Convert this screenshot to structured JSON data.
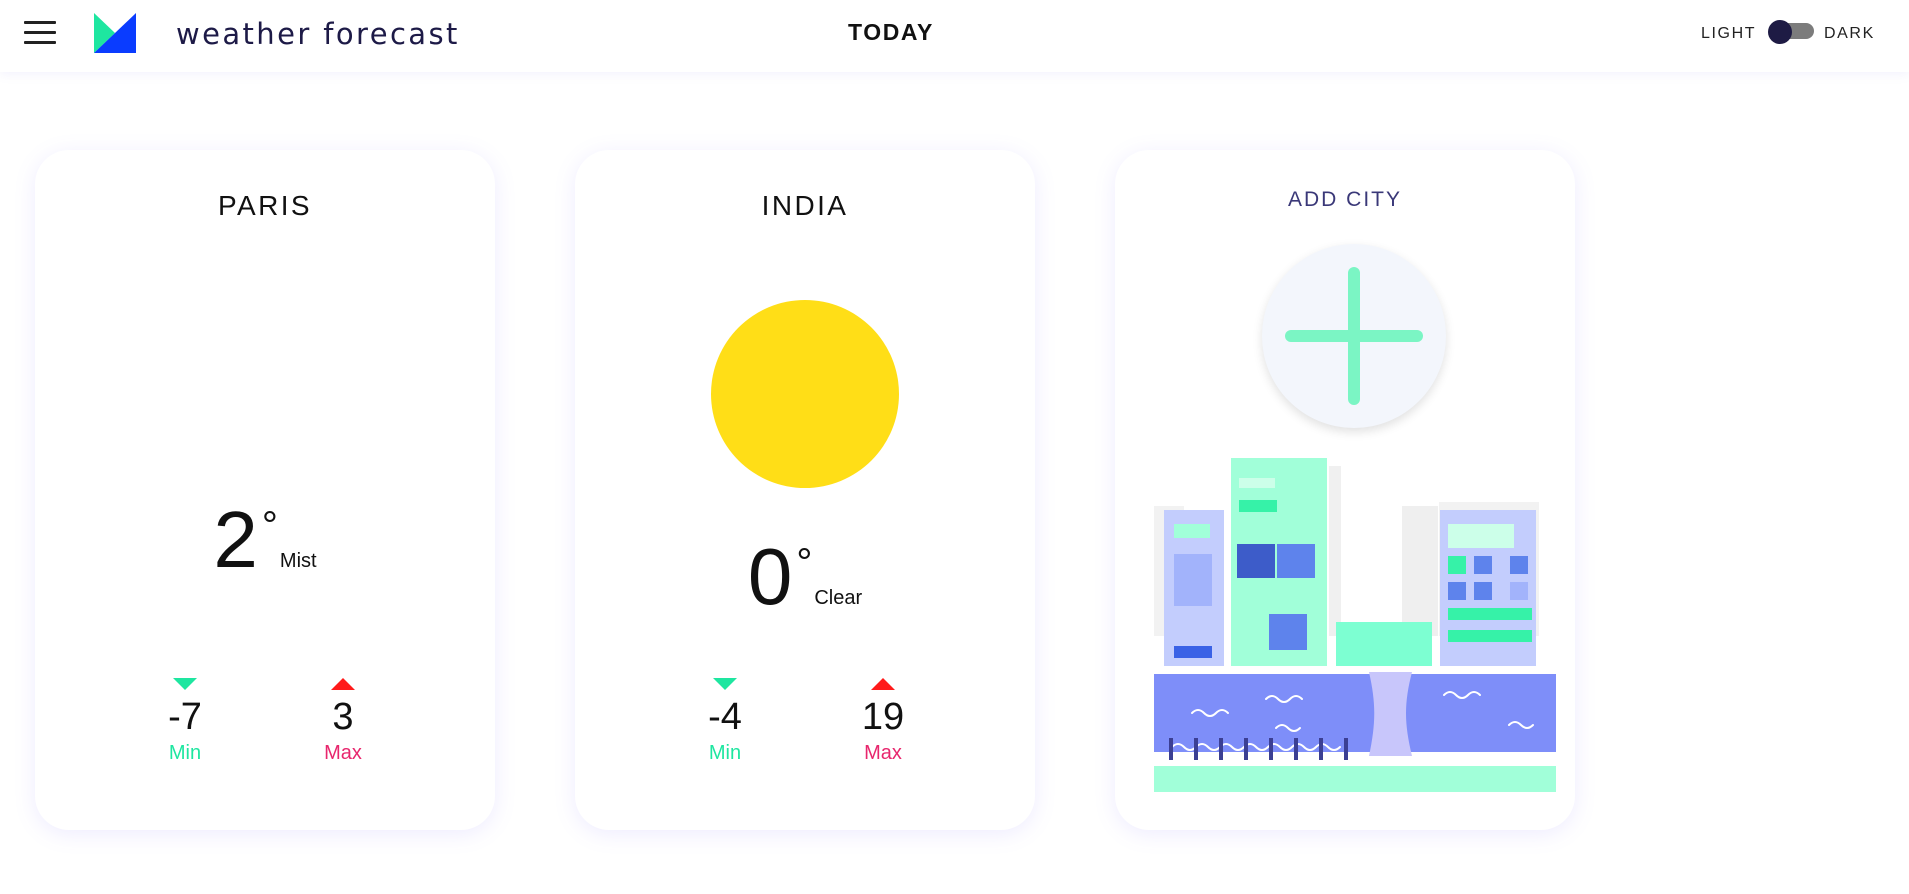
{
  "header": {
    "title": "weather forecast",
    "center_label": "TODAY",
    "theme_light_label": "LIGHT",
    "theme_dark_label": "DARK",
    "menu_icon": "hamburger-menu-icon",
    "logo_icon": "app-logo-icon"
  },
  "cards": [
    {
      "city": "PARIS",
      "temperature": "2",
      "degree_symbol": "°",
      "condition": "Mist",
      "min_value": "-7",
      "min_label": "Min",
      "max_value": "3",
      "max_label": "Max"
    },
    {
      "city": "INDIA",
      "temperature": "0",
      "degree_symbol": "°",
      "condition": "Clear",
      "weather_icon": "sun-icon",
      "min_value": "-4",
      "min_label": "Min",
      "max_value": "19",
      "max_label": "Max"
    }
  ],
  "add_city": {
    "title": "ADD CITY",
    "icon": "plus-icon"
  },
  "colors": {
    "brand_dark": "#1d1a47",
    "min_green": "#1ee6a0",
    "max_red": "#e8266d",
    "arrow_red": "#ff1a1a",
    "sun_yellow": "#ffde17",
    "plus_mint": "#7bf5c4",
    "toggle_knob": "#1e1b44"
  }
}
